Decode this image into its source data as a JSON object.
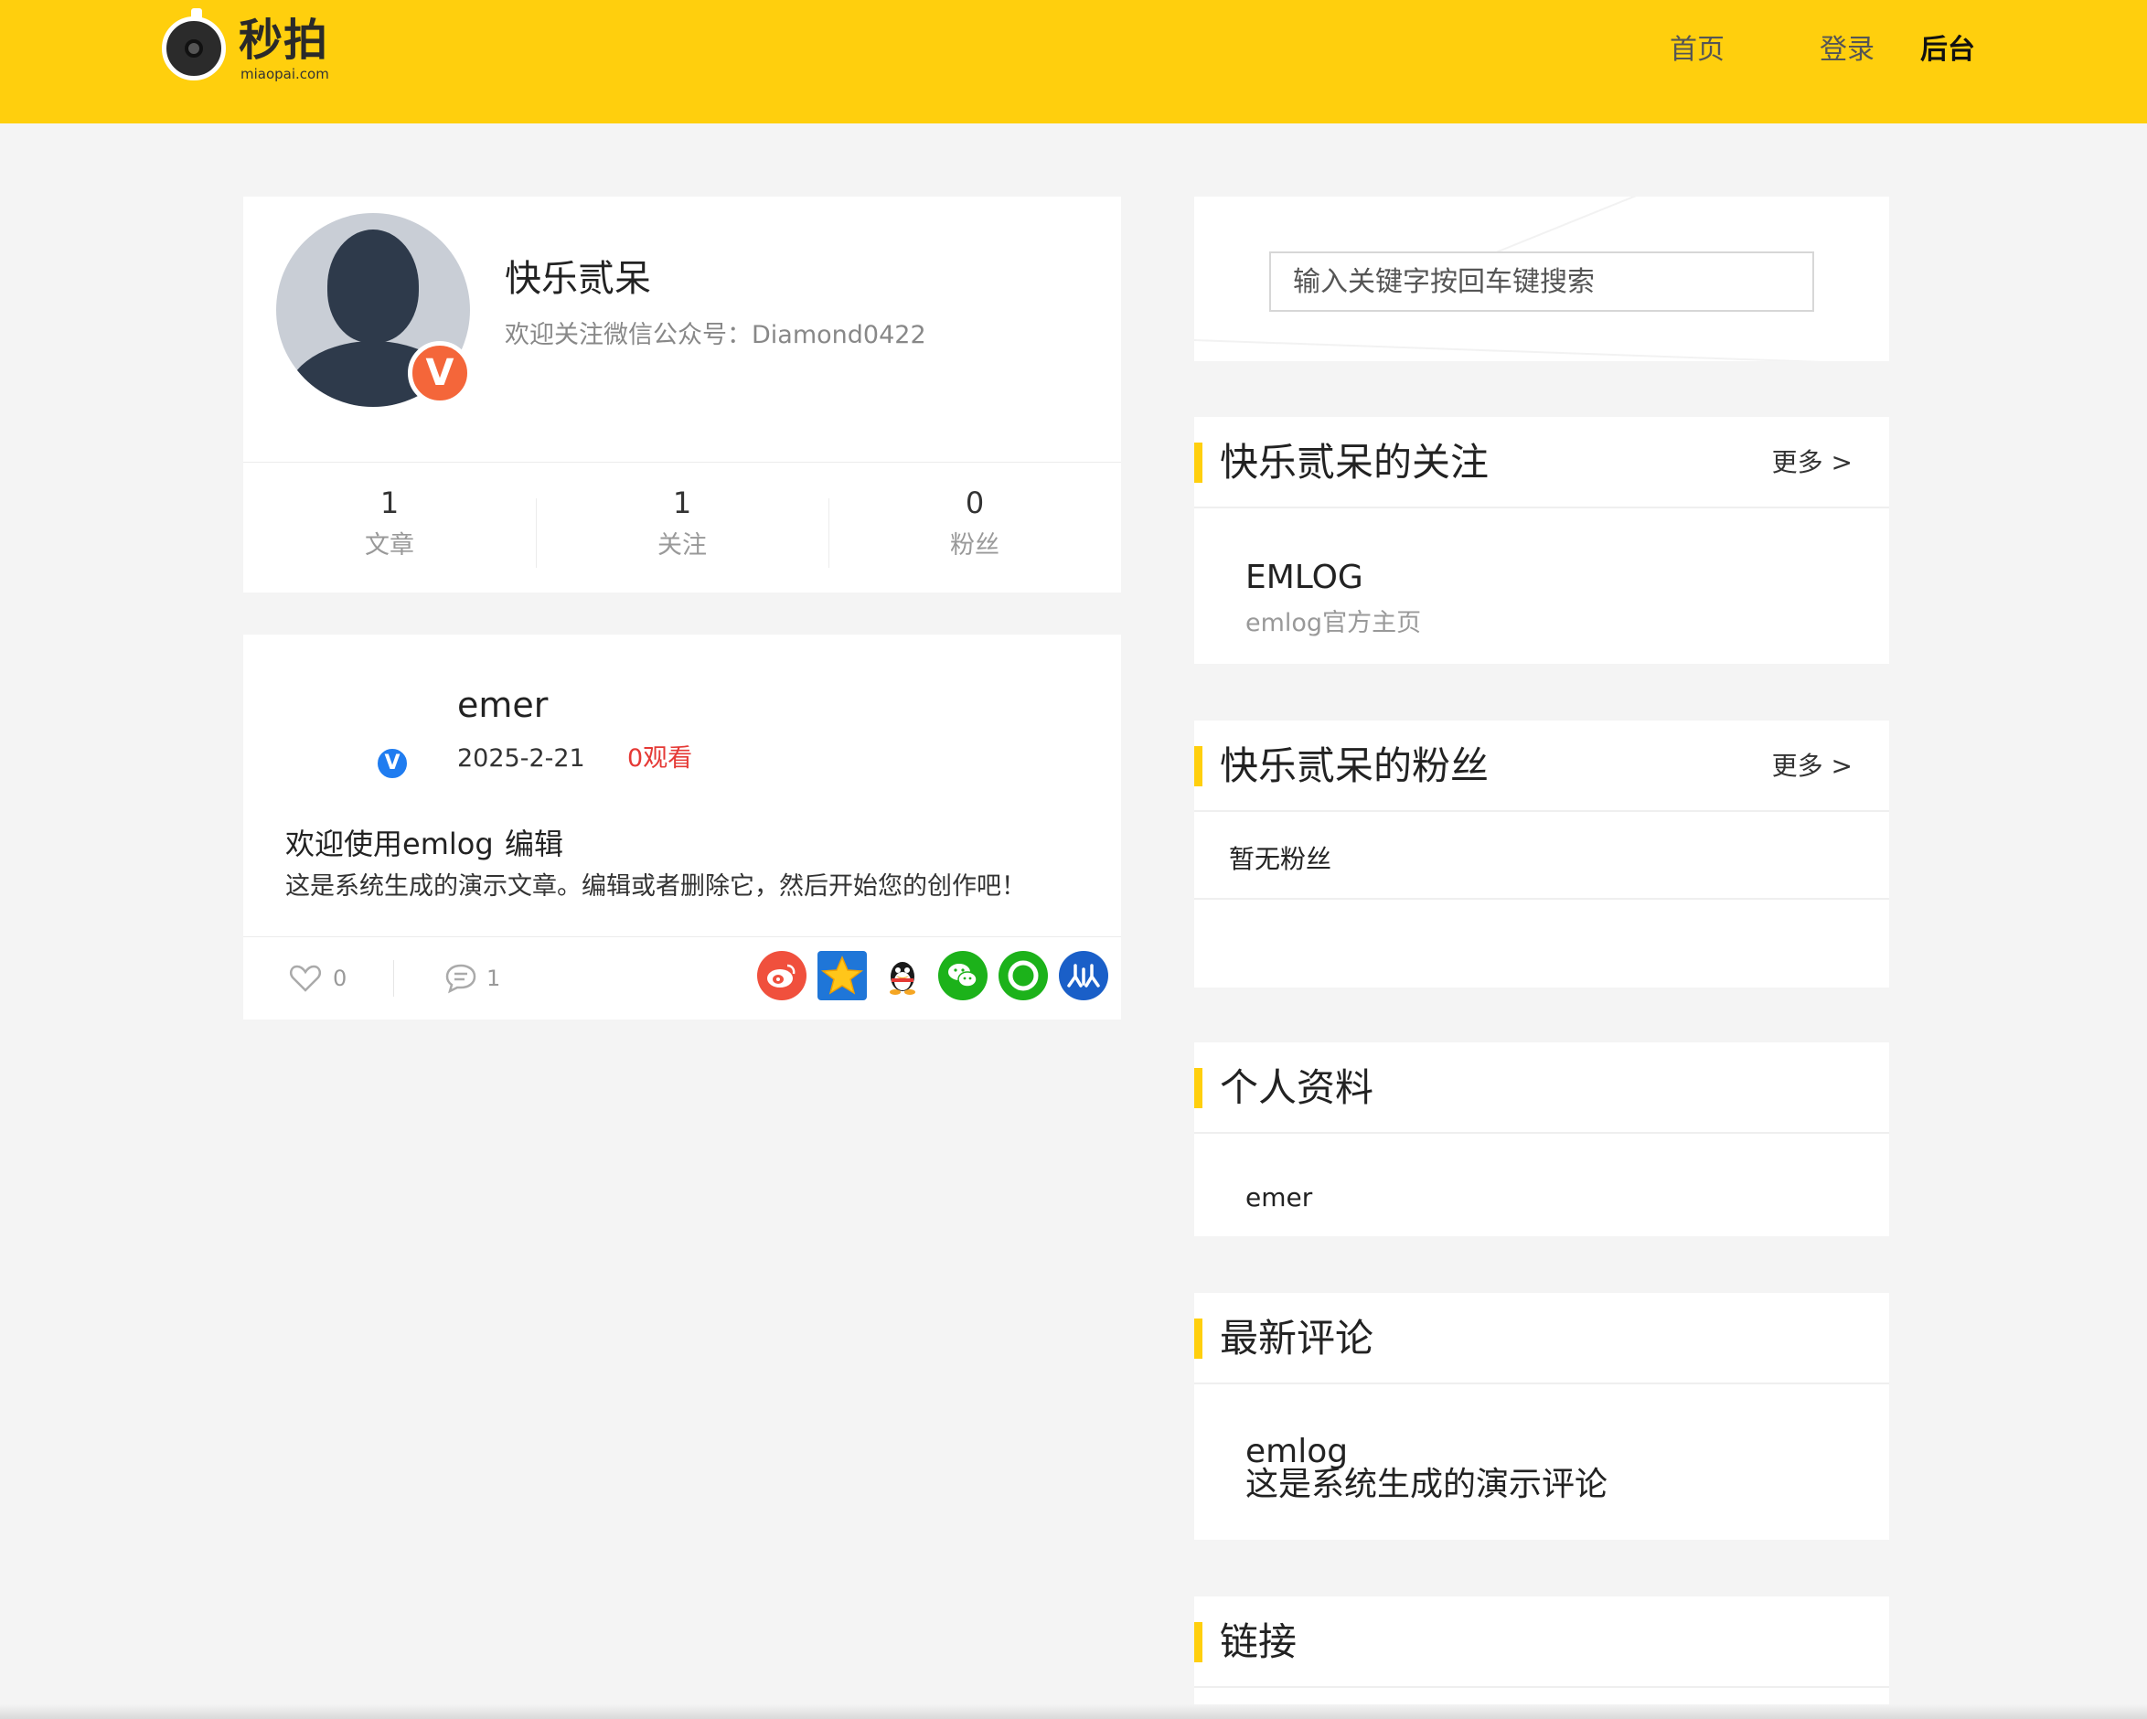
{
  "header": {
    "logo_text": "秒拍",
    "logo_sub": "miaopai.com",
    "nav": {
      "home": "首页",
      "login": "登录",
      "admin": "后台"
    },
    "colors": {
      "brand": "#ffcf0d"
    }
  },
  "profile": {
    "name": "快乐贰呆",
    "description": "欢迎关注微信公众号：Diamond0422",
    "badge": "V",
    "stats": [
      {
        "value": "1",
        "label": "文章"
      },
      {
        "value": "1",
        "label": "关注"
      },
      {
        "value": "0",
        "label": "粉丝"
      }
    ]
  },
  "article": {
    "badge": "V",
    "author": "emer",
    "date": "2025-2-21",
    "views": "0观看",
    "title": "欢迎使用emlog",
    "edit_label": "编辑",
    "excerpt": "这是系统生成的演示文章。编辑或者删除它，然后开始您的创作吧！",
    "likes": "0",
    "comments": "1",
    "share_icons": [
      "weibo-icon",
      "qzone-icon",
      "qq-icon",
      "wechat-icon",
      "moments-icon",
      "renren-icon"
    ]
  },
  "sidebar": {
    "search": {
      "placeholder": "输入关键字按回车键搜索"
    },
    "following": {
      "title": "快乐贰呆的关注",
      "more": "更多 >",
      "items": [
        {
          "name": "EMLOG",
          "desc": "emlog官方主页"
        }
      ]
    },
    "fans": {
      "title": "快乐贰呆的粉丝",
      "more": "更多 >",
      "empty": "暂无粉丝"
    },
    "profile_info": {
      "title": "个人资料",
      "text": "emer"
    },
    "latest_comments": {
      "title": "最新评论",
      "items": [
        {
          "author": "emlog",
          "text": "这是系统生成的演示评论"
        }
      ]
    },
    "links": {
      "title": "链接"
    }
  }
}
